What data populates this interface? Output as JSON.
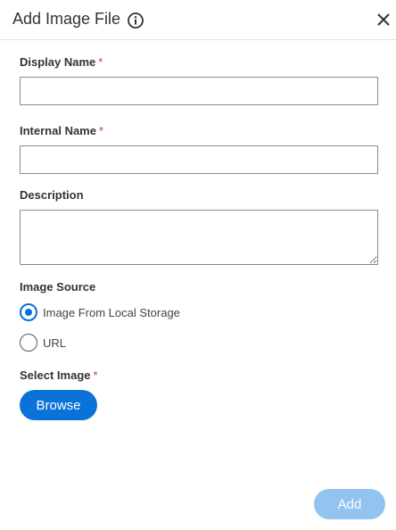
{
  "dialog": {
    "title": "Add Image File"
  },
  "form": {
    "display_name": {
      "label": "Display Name",
      "required_mark": "*",
      "value": ""
    },
    "internal_name": {
      "label": "Internal Name",
      "required_mark": "*",
      "value": ""
    },
    "description": {
      "label": "Description",
      "value": ""
    },
    "image_source": {
      "label": "Image Source",
      "options": [
        {
          "label": "Image From Local Storage",
          "selected": true
        },
        {
          "label": "URL",
          "selected": false
        }
      ]
    },
    "select_image": {
      "label": "Select Image",
      "required_mark": "*"
    }
  },
  "buttons": {
    "browse": "Browse",
    "add": "Add"
  },
  "colors": {
    "primary": "#0a72d8",
    "primary_disabled": "#93c3ef",
    "required": "#d0383e"
  },
  "icons": {
    "info": "info-circle-icon",
    "close": "close-icon"
  }
}
